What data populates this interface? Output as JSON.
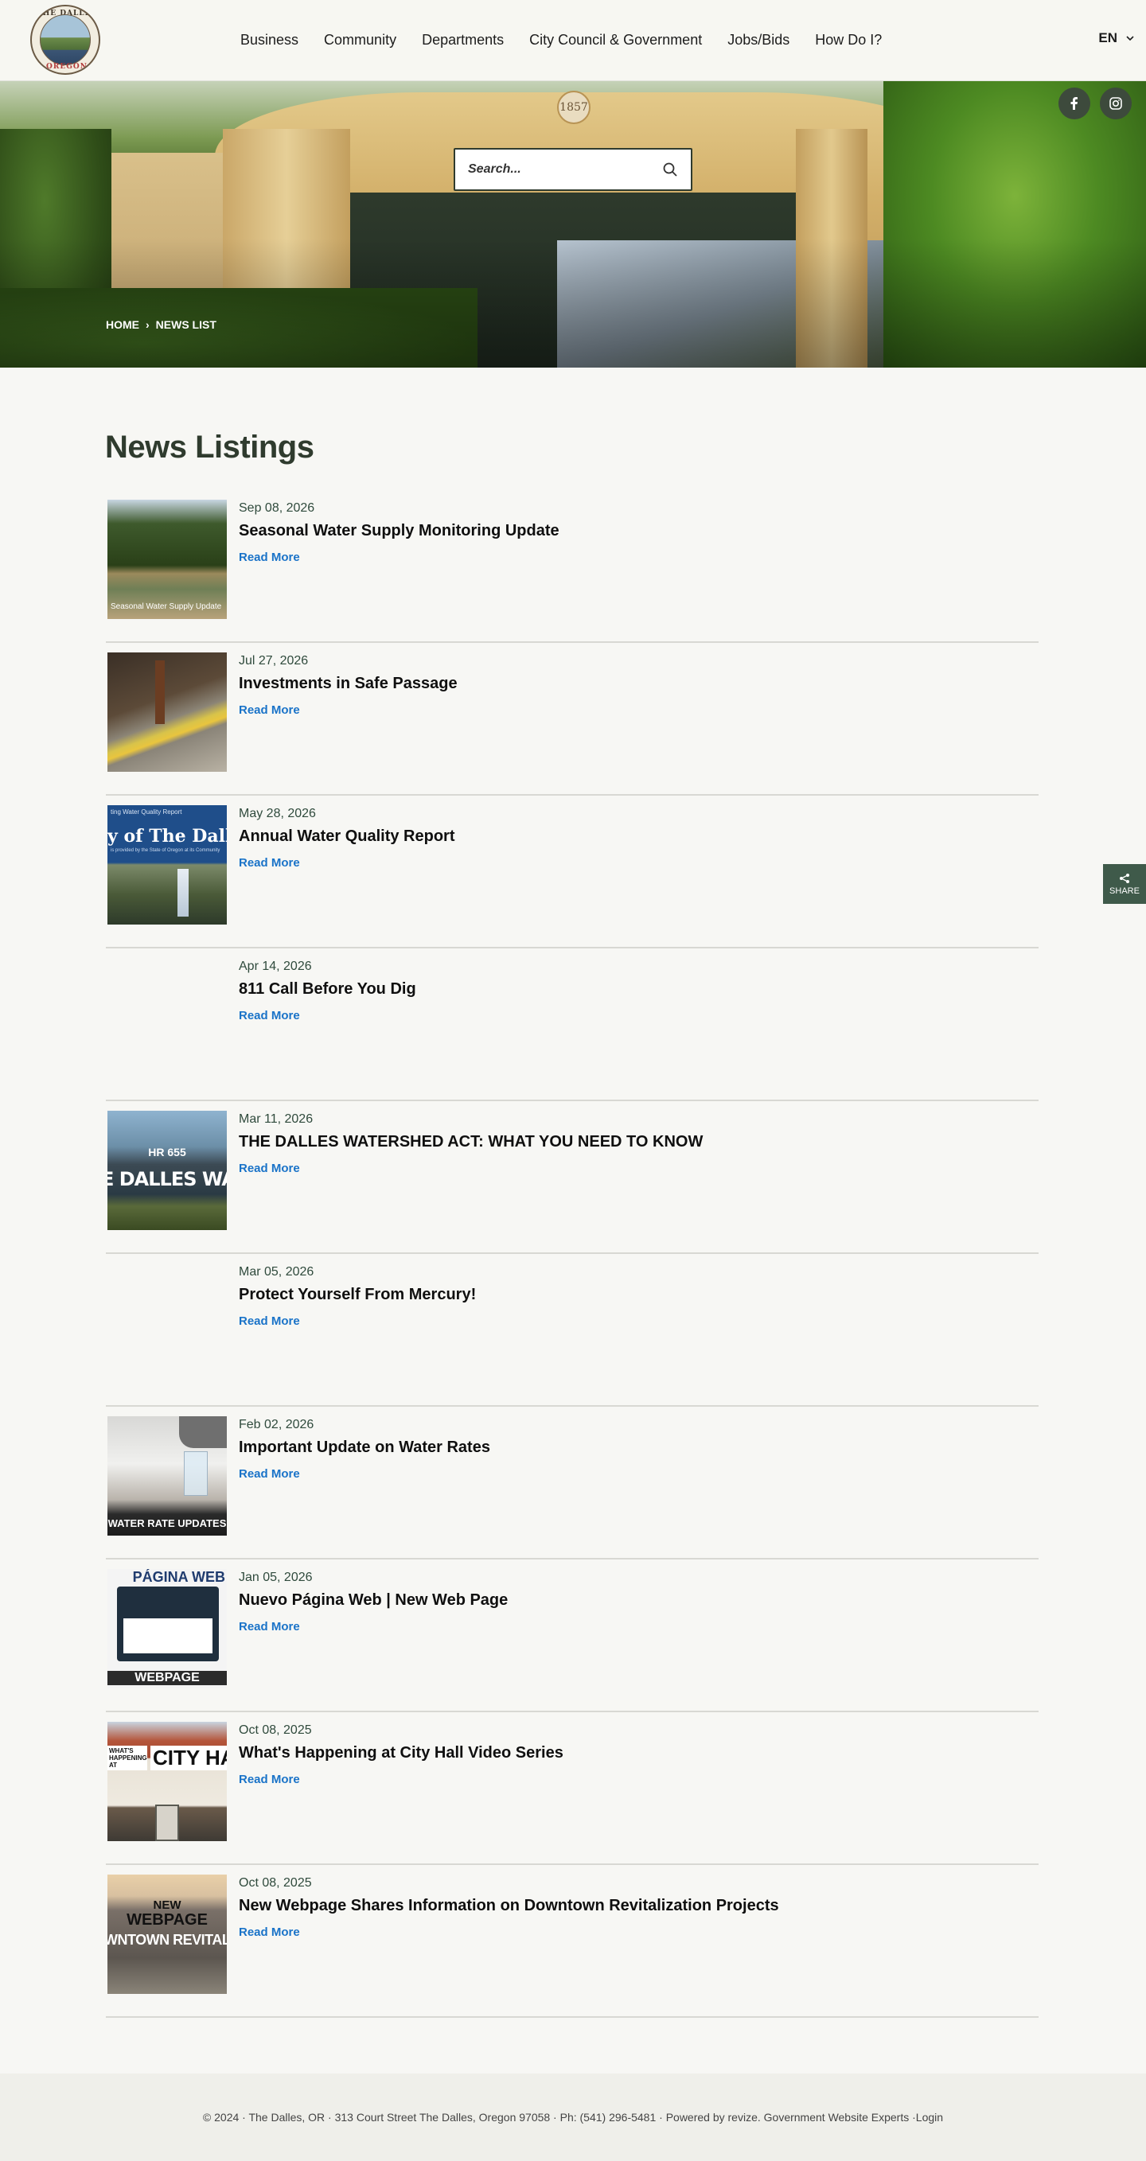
{
  "header": {
    "logo_top": "THE DALLES",
    "logo_bottom": "OREGON",
    "nav": [
      "Business",
      "Community",
      "Departments",
      "City Council & Government",
      "Jobs/Bids",
      "How Do I?"
    ],
    "language": "EN"
  },
  "hero": {
    "medallion": "1857",
    "search_placeholder": "Search...",
    "social": [
      "facebook-icon",
      "instagram-icon"
    ],
    "breadcrumb": [
      "HOME",
      "NEWS LIST"
    ]
  },
  "main": {
    "title": "News Listings",
    "read_more_label": "Read More",
    "news": [
      {
        "date": "Sep 08, 2026",
        "title": "Seasonal Water Supply Monitoring Update",
        "thumb_caption": "Seasonal Water Supply Update"
      },
      {
        "date": "Jul 27, 2026",
        "title": "Investments in Safe Passage"
      },
      {
        "date": "May 28, 2026",
        "title": "Annual Water Quality Report",
        "thumb_line1": "ting Water Quality Report",
        "thumb_line2": "y of The Dalles",
        "thumb_line3": "is provided by the State of Oregon at its Community"
      },
      {
        "date": "Apr 14, 2026",
        "title": "811 Call Before You Dig"
      },
      {
        "date": "Mar 11, 2026",
        "title": "THE DALLES WATERSHED ACT: WHAT YOU NEED TO KNOW",
        "thumb_line1": "HR 655",
        "thumb_line2": "E DALLES WATERSHED"
      },
      {
        "date": "Mar 05, 2026",
        "title": "Protect Yourself From Mercury!"
      },
      {
        "date": "Feb 02, 2026",
        "title": "Important Update on Water Rates",
        "thumb_caption": "WATER RATE UPDATES"
      },
      {
        "date": "Jan 05, 2026",
        "title": "Nuevo Página Web | New Web Page",
        "thumb_line1": "PÁGINA WEB",
        "thumb_line2": "WEBPAGE"
      },
      {
        "date": "Oct 08, 2025",
        "title": "What's Happening at City Hall Video Series",
        "thumb_line1": "WHAT'S HAPPENING AT",
        "thumb_line2": "CITY HAI"
      },
      {
        "date": "Oct 08, 2025",
        "title": "New Webpage Shares Information on Downtown Revitalization Projects",
        "thumb_line1": "NEW",
        "thumb_line2": "WEBPAGE",
        "thumb_line3": "WNTOWN REVITALIZAT"
      }
    ]
  },
  "share_label": "SHARE",
  "footer": {
    "text": "© 2024 · The Dalles, OR · 313 Court Street The Dalles, Oregon 97058 · Ph: (541) 296-5481 · Powered by revize. Government Website Experts · ",
    "login": "Login"
  },
  "colors": {
    "accent_dark_green": "#2f3b2e",
    "link_blue": "#1a73c8",
    "share_bg": "#3f5a4a"
  }
}
